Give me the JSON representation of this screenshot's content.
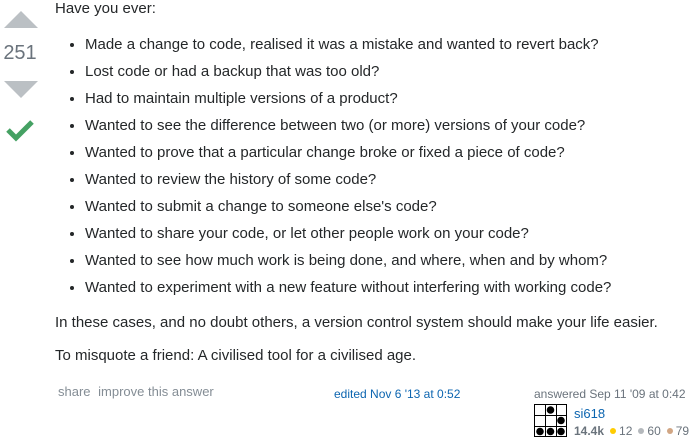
{
  "vote": {
    "score": "251"
  },
  "post": {
    "intro": "Have you ever:",
    "items": [
      "Made a change to code, realised it was a mistake and wanted to revert back?",
      "Lost code or had a backup that was too old?",
      "Had to maintain multiple versions of a product?",
      "Wanted to see the difference between two (or more) versions of your code?",
      "Wanted to prove that a particular change broke or fixed a piece of code?",
      "Wanted to review the history of some code?",
      "Wanted to submit a change to someone else's code?",
      "Wanted to share your code, or let other people work on your code?",
      "Wanted to see how much work is being done, and where, when and by whom?",
      "Wanted to experiment with a new feature without interfering with working code?"
    ],
    "para2": "In these cases, and no doubt others, a version control system should make your life easier.",
    "para3": "To misquote a friend: A civilised tool for a civilised age."
  },
  "menu": {
    "share": "share",
    "improve": "improve this answer"
  },
  "edited": "edited Nov 6 '13 at 0:52",
  "answered": "answered Sep 11 '09 at 0:42",
  "user": {
    "name": "si618",
    "reputation": "14.4k",
    "gold": "12",
    "silver": "60",
    "bronze": "79"
  },
  "colors": {
    "gold": "#ffcc01",
    "silver": "#b4b8bc",
    "bronze": "#d1a684",
    "accepted": "#45a163",
    "link": "#0c65b0"
  },
  "icons": {
    "upvote": "triangle-up",
    "downvote": "triangle-down",
    "accepted": "checkmark",
    "avatar": "pixel-identicon"
  }
}
